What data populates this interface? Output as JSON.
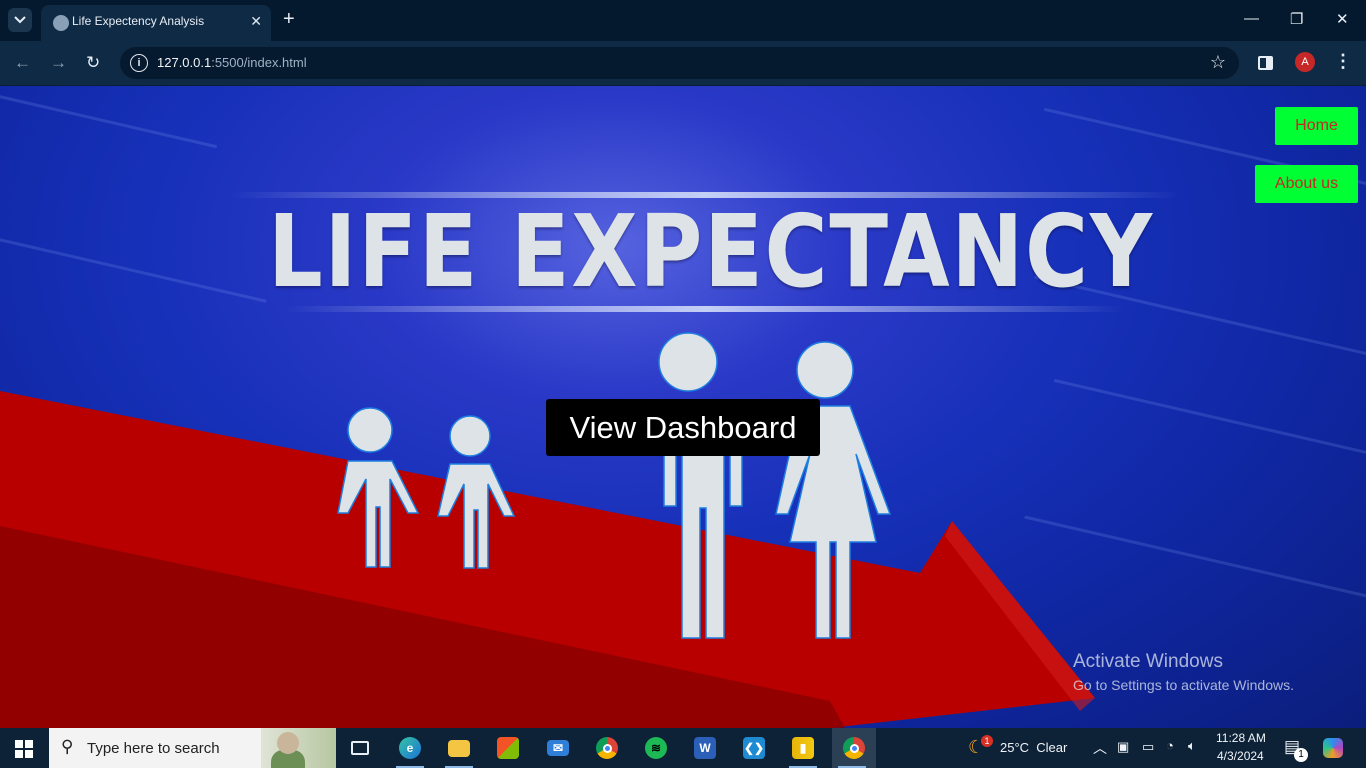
{
  "browser": {
    "tab_title": "Life Expectency Analysis",
    "url_host": "127.0.0.1",
    "url_rest": ":5500/index.html",
    "profile_initial": "A"
  },
  "page": {
    "headline": "LIFE EXPECTANCY",
    "nav": {
      "home": "Home",
      "about": "About us"
    },
    "cta": "View Dashboard",
    "colors": {
      "nav_bg": "#00ff33",
      "nav_text": "#c62828",
      "cta_bg": "#000000",
      "arrow": "#c00000",
      "figures": "#dde3e6"
    }
  },
  "watermark": {
    "line1": "Activate Windows",
    "line2": "Go to Settings to activate Windows."
  },
  "taskbar": {
    "search_placeholder": "Type here to search",
    "weather": "25°C  Clear",
    "weather_badge": "1",
    "time": "11:28 AM",
    "date": "4/3/2024",
    "notification_count": "1",
    "apps": [
      "task-view",
      "edge",
      "file-explorer",
      "microsoft-store",
      "mail",
      "chrome",
      "spotify",
      "word",
      "vscode",
      "power-bi",
      "chrome-profile"
    ]
  }
}
